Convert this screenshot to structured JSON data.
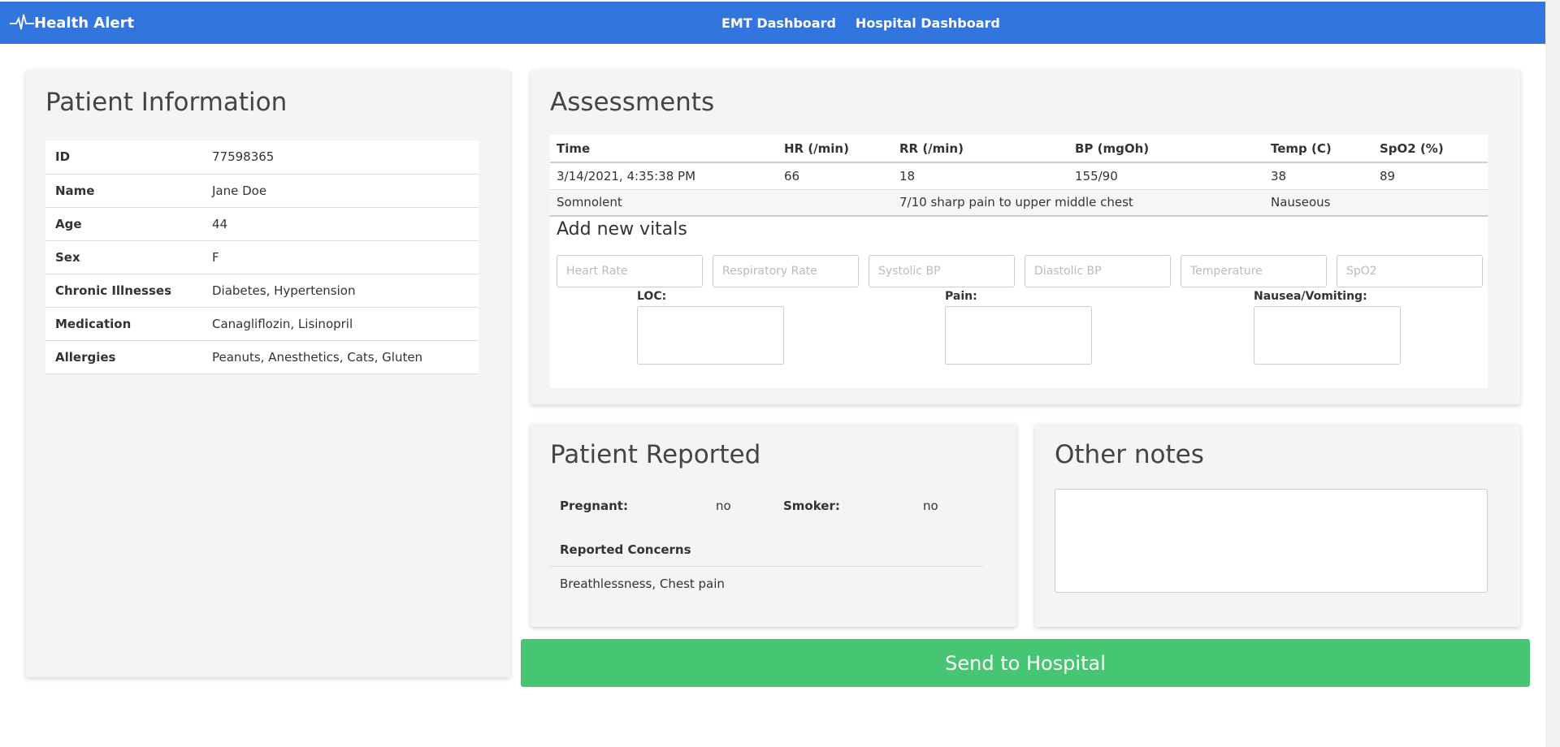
{
  "nav": {
    "brand": "Health Alert",
    "links": [
      "EMT Dashboard",
      "Hospital Dashboard"
    ]
  },
  "patient": {
    "title": "Patient Information",
    "rows": [
      {
        "key": "ID",
        "value": "77598365"
      },
      {
        "key": "Name",
        "value": "Jane Doe"
      },
      {
        "key": "Age",
        "value": "44"
      },
      {
        "key": "Sex",
        "value": "F"
      },
      {
        "key": "Chronic Illnesses",
        "value": "Diabetes, Hypertension"
      },
      {
        "key": "Medication",
        "value": "Canagliflozin, Lisinopril"
      },
      {
        "key": "Allergies",
        "value": "Peanuts, Anesthetics, Cats, Gluten"
      }
    ]
  },
  "assessments": {
    "title": "Assessments",
    "headers": [
      "Time",
      "HR (/min)",
      "RR (/min)",
      "BP (mgOh)",
      "Temp (C)",
      "SpO2 (%)"
    ],
    "row": [
      "3/14/2021, 4:35:38 PM",
      "66",
      "18",
      "155/90",
      "38",
      "89"
    ],
    "notes": {
      "loc": "Somnolent",
      "pain": "7/10 sharp pain to upper middle chest",
      "nausea": "Nauseous"
    },
    "add_title": "Add new vitals",
    "placeholders": [
      "Heart Rate",
      "Respiratory Rate",
      "Systolic BP",
      "Diastolic BP",
      "Temperature",
      "SpO2"
    ],
    "loc_label": "LOC:",
    "pain_label": "Pain:",
    "nausea_label": "Nausea/Vomiting:"
  },
  "reported": {
    "title": "Patient Reported",
    "pregnant_label": "Pregnant:",
    "pregnant_value": "no",
    "smoker_label": "Smoker:",
    "smoker_value": "no",
    "concerns_label": "Reported Concerns",
    "concerns_value": "Breathlessness, Chest pain"
  },
  "notes": {
    "title": "Other notes"
  },
  "send_label": "Send to Hospital"
}
